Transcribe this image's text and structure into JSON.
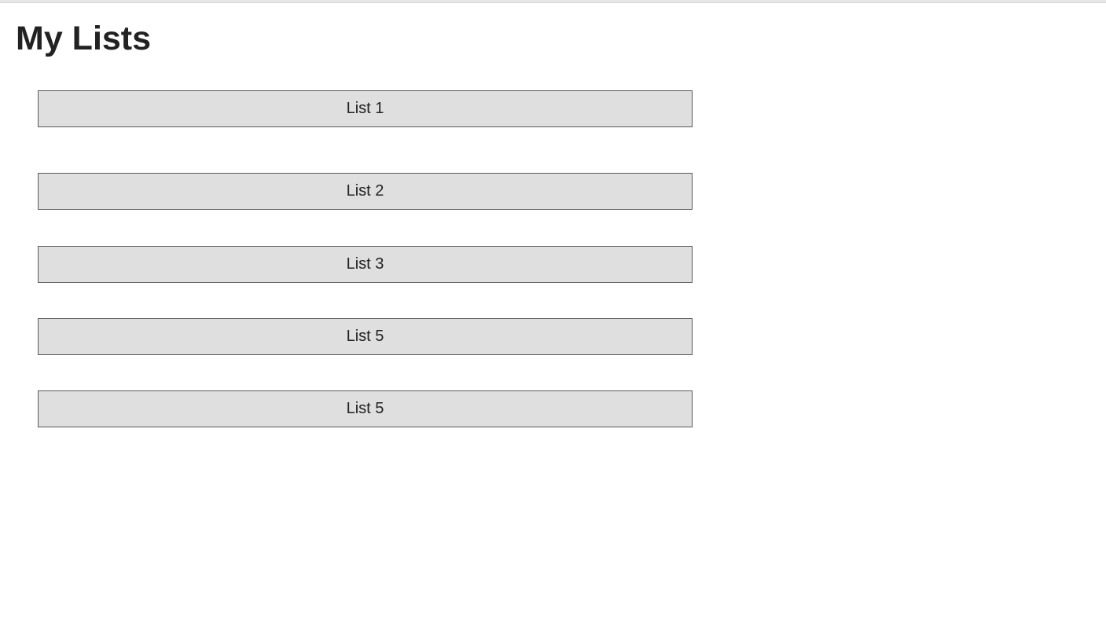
{
  "page": {
    "title": "My Lists"
  },
  "lists": [
    {
      "label": "List 1"
    },
    {
      "label": "List 2"
    },
    {
      "label": "List 3"
    },
    {
      "label": "List 5"
    },
    {
      "label": "List 5"
    }
  ],
  "colors": {
    "button_background": "#dfdfdf",
    "button_border": "#5a5a5a",
    "text": "#222222",
    "page_background": "#ffffff"
  }
}
